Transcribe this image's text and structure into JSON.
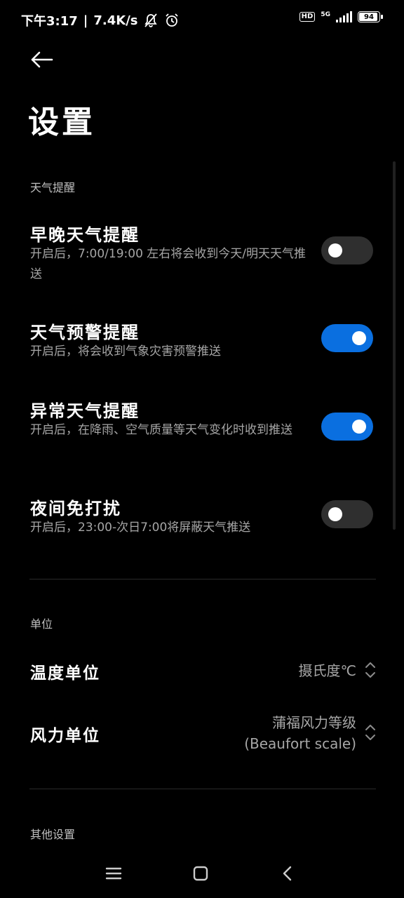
{
  "status_bar": {
    "time": "下午3:17",
    "speed": "7.4K/s",
    "hd_badge": "HD",
    "network": "5G",
    "battery_level": 94,
    "battery_text": "94"
  },
  "header": {
    "title": "设置"
  },
  "weather_alerts": {
    "section_label": "天气提醒",
    "items": [
      {
        "title": "早晚天气提醒",
        "description": "开启后，7:00/19:00 左右将会收到今天/明天天气推送",
        "enabled": false
      },
      {
        "title": "天气预警提醒",
        "description": "开启后，将会收到气象灾害预警推送",
        "enabled": true
      },
      {
        "title": "异常天气提醒",
        "description": "开启后，在降雨、空气质量等天气变化时收到推送",
        "enabled": true
      },
      {
        "title": "夜间免打扰",
        "description": "开启后，23:00-次日7:00将屏蔽天气推送",
        "enabled": false
      }
    ]
  },
  "units": {
    "section_label": "单位",
    "temperature": {
      "label": "温度单位",
      "value": "摄氏度℃"
    },
    "wind": {
      "label": "风力单位",
      "value_line1": "蒲福风力等级",
      "value_line2": "(Beaufort scale)"
    }
  },
  "other": {
    "section_label": "其他设置"
  },
  "icons": {
    "back": "back-arrow-icon",
    "dropdown": "up-down-chevron-icon",
    "nav_menu": "menu-icon",
    "nav_home": "home-square-icon",
    "nav_back": "back-chevron-icon"
  },
  "colors": {
    "background": "#000000",
    "toggle_on": "#0a6fe0",
    "toggle_off": "#2f2f2f"
  }
}
